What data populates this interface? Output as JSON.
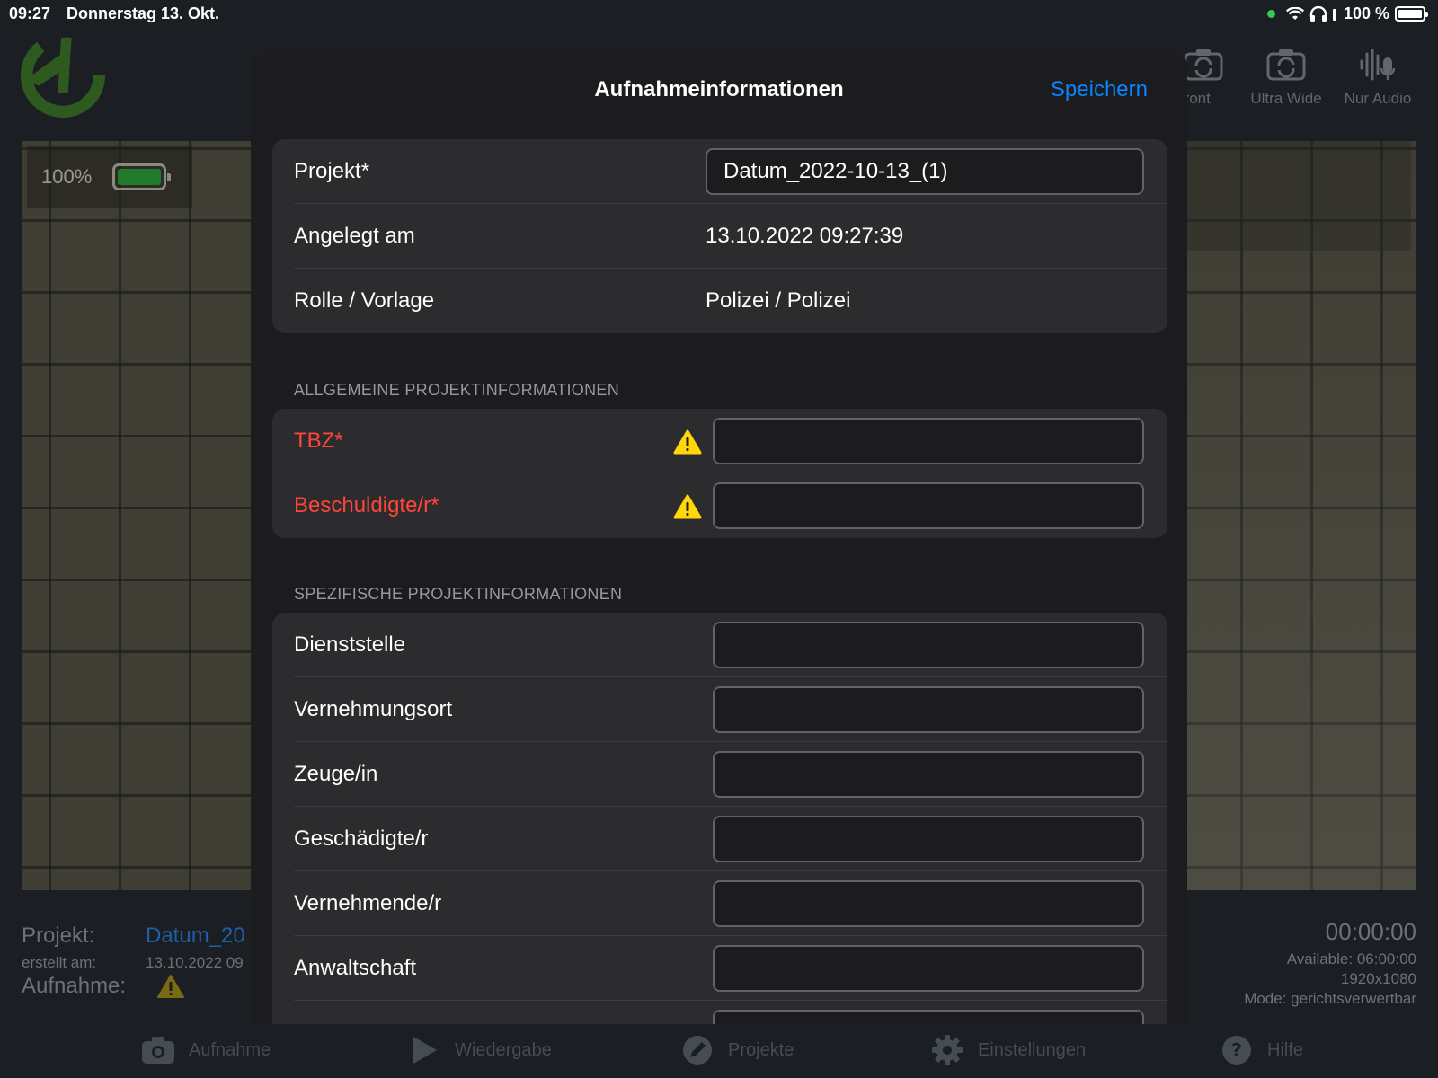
{
  "status_bar": {
    "time": "09:27",
    "date": "Donnerstag 13. Okt.",
    "battery": "100 %"
  },
  "background": {
    "battery_overlay": "100%",
    "tools": [
      {
        "label": "Front",
        "icon": "camera-rotate-icon"
      },
      {
        "label": "Ultra Wide",
        "icon": "camera-rotate-icon"
      },
      {
        "label": "Nur Audio",
        "icon": "microphone-waveform-icon"
      }
    ],
    "project_label": "Projekt:",
    "project_value": "Datum_20",
    "created_label": "erstellt am:",
    "created_value": "13.10.2022 09",
    "recording_label": "Aufnahme:",
    "timer": "00:00:00",
    "available": "Available: 06:00:00",
    "resolution": "1920x1080",
    "mode": "Mode: gerichtsverwertbar",
    "tabs": [
      {
        "label": "Aufnahme",
        "icon": "camera-icon"
      },
      {
        "label": "Wiedergabe",
        "icon": "play-icon"
      },
      {
        "label": "Projekte",
        "icon": "pencil-circle-icon"
      },
      {
        "label": "Einstellungen",
        "icon": "gear-icon"
      },
      {
        "label": "Hilfe",
        "icon": "help-icon"
      }
    ]
  },
  "modal": {
    "title": "Aufnahmeinformationen",
    "save_label": "Speichern",
    "project": {
      "label": "Projekt*",
      "value": "Datum_2022-10-13_(1)"
    },
    "created": {
      "label": "Angelegt am",
      "value": "13.10.2022 09:27:39"
    },
    "role": {
      "label": "Rolle / Vorlage",
      "value": "Polizei / Polizei"
    },
    "general_header": "ALLGEMEINE PROJEKTINFORMATIONEN",
    "general_fields": [
      {
        "label": "TBZ*",
        "value": ""
      },
      {
        "label": "Beschuldigte/r*",
        "value": ""
      }
    ],
    "specific_header": "SPEZIFISCHE PROJEKTINFORMATIONEN",
    "specific_fields": [
      {
        "label": "Dienststelle",
        "value": ""
      },
      {
        "label": "Vernehmungsort",
        "value": ""
      },
      {
        "label": "Zeuge/in",
        "value": ""
      },
      {
        "label": "Geschädigte/r",
        "value": ""
      },
      {
        "label": "Vernehmende/r",
        "value": ""
      },
      {
        "label": "Anwaltschaft",
        "value": ""
      }
    ]
  },
  "colors": {
    "accent": "#0a84ff",
    "required": "#ff453a",
    "warning": "#ffd60a"
  }
}
